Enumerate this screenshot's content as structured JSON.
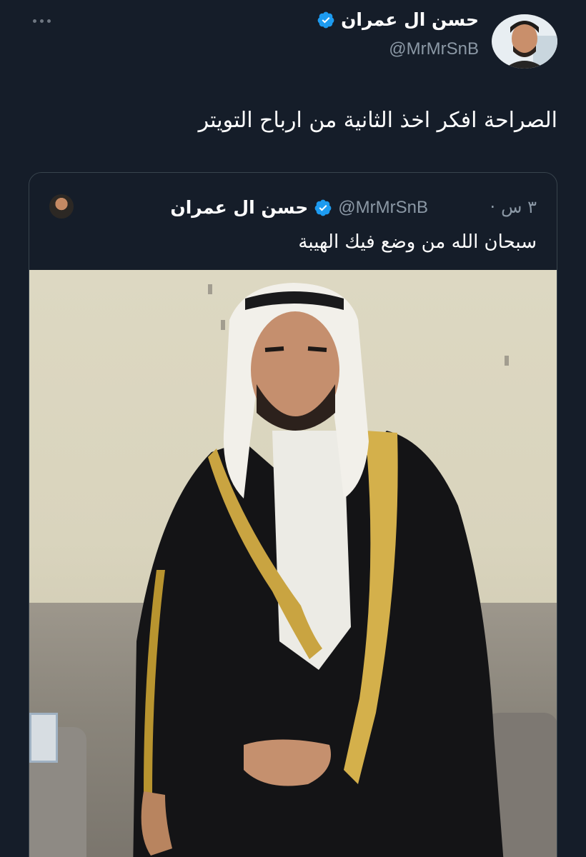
{
  "tweet": {
    "author": {
      "name": "حسن ال عمران",
      "handle": "@MrMrSnB",
      "verified": true
    },
    "more_icon": "more-horizontal-icon",
    "text": "الصراحة افكر اخذ الثانية من ارباح التويتر"
  },
  "quoted_tweet": {
    "author": {
      "name": "حسن ال عمران",
      "handle": "@MrMrSnB",
      "verified": true
    },
    "separator": "·",
    "time": "٣ س",
    "text": "سبحان الله من وضع فيك الهيبة",
    "media": "photo"
  },
  "colors": {
    "background": "#151d29",
    "text_primary": "#ffffff",
    "text_secondary": "#8b98a5",
    "verified": "#1d9bf0",
    "border": "#38444d"
  }
}
